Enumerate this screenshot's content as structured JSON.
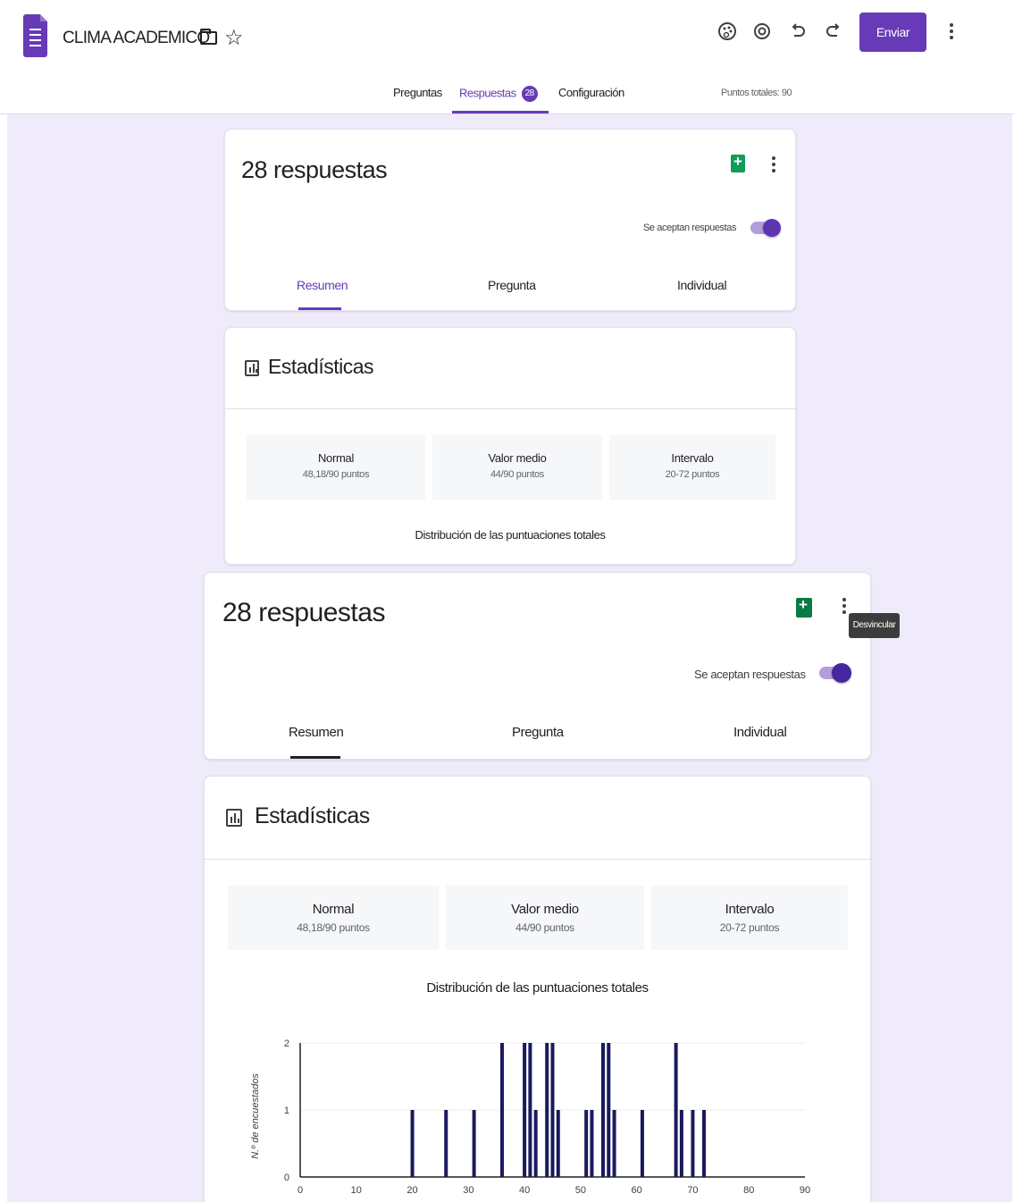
{
  "header": {
    "title": "CLIMA ACADEMICO",
    "send_label": "Enviar",
    "icons": [
      "form-doc-icon",
      "folder-icon",
      "star-icon",
      "palette-icon",
      "eye-icon",
      "undo-icon",
      "redo-icon",
      "more-vert-icon"
    ]
  },
  "tabs": {
    "questions": "Preguntas",
    "responses": "Respuestas",
    "responses_count": "28",
    "settings": "Configuración",
    "total_points": "Puntos totales: 90"
  },
  "colors": {
    "accent": "#673ab7",
    "background": "#efebfb",
    "sheets": "#0f9d58",
    "bar": "#1a1a5e"
  },
  "summary_card": {
    "title": "28 respuestas",
    "accepting_label": "Se aceptan respuestas",
    "accepting": true,
    "tooltip": "Desvincular",
    "subtabs": [
      "Resumen",
      "Pregunta",
      "Individual"
    ],
    "active_subtab": "Resumen"
  },
  "stats": {
    "title": "Estadísticas",
    "boxes": [
      {
        "label": "Normal",
        "value": "48,18/90 puntos"
      },
      {
        "label": "Valor medio",
        "value": "44/90 puntos"
      },
      {
        "label": "Intervalo",
        "value": "20-72 puntos"
      }
    ],
    "distribution_title": "Distribución de las puntuaciones totales"
  },
  "chart_data": {
    "type": "bar",
    "title": "Distribución de las puntuaciones totales",
    "xlabel": "",
    "ylabel": "N.º de encuestados",
    "xlim": [
      0,
      90
    ],
    "ylim": [
      0,
      2
    ],
    "xticks": [
      0,
      10,
      20,
      30,
      40,
      50,
      60,
      70,
      80,
      90
    ],
    "yticks": [
      0,
      1,
      2
    ],
    "grid": true,
    "x": [
      20,
      26,
      31,
      36,
      40,
      41,
      42,
      44,
      45,
      46,
      51,
      52,
      54,
      55,
      56,
      61,
      67,
      68,
      70,
      72
    ],
    "values": [
      1,
      1,
      1,
      2,
      2,
      2,
      1,
      2,
      2,
      1,
      1,
      1,
      2,
      2,
      1,
      1,
      2,
      1,
      1,
      1
    ]
  }
}
